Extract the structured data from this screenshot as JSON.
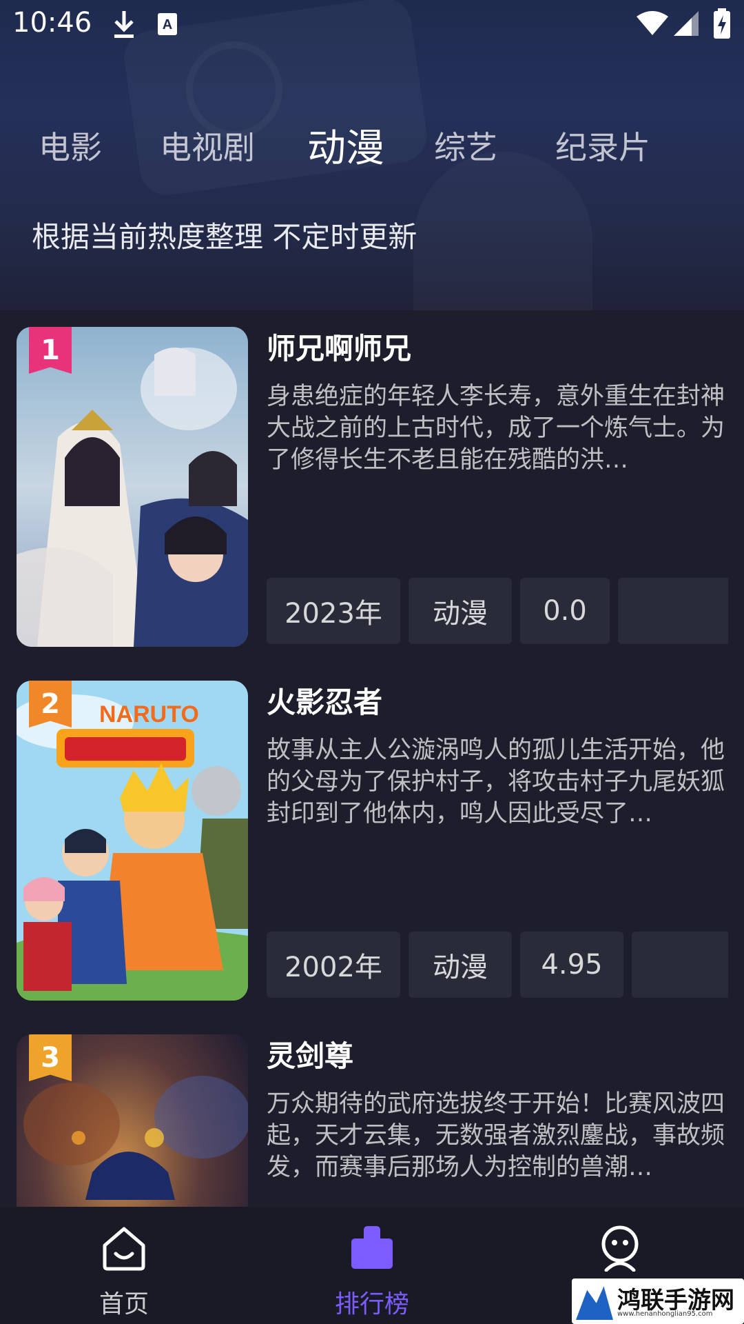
{
  "status_bar": {
    "time": "10:46",
    "icons": [
      "download-icon",
      "autofill-a-icon",
      "wifi-icon",
      "signal-icon",
      "battery-charging-icon"
    ]
  },
  "header": {
    "tabs": [
      {
        "label": "电影",
        "active": false
      },
      {
        "label": "电视剧",
        "active": false
      },
      {
        "label": "动漫",
        "active": true
      },
      {
        "label": "综艺",
        "active": false
      },
      {
        "label": "纪录片",
        "active": false
      }
    ],
    "subtitle": "根据当前热度整理 不定时更新"
  },
  "ranking": {
    "items": [
      {
        "rank": "1",
        "rank_color": "#e8337a",
        "title": "师兄啊师兄",
        "description": "身患绝症的年轻人李长寿，意外重生在封神大战之前的上古时代，成了一个炼气士。为了修得长生不老且能在残酷的洪…",
        "tags": [
          "2023年",
          "动漫",
          "0.0"
        ]
      },
      {
        "rank": "2",
        "rank_color": "#f0882a",
        "title": "火影忍者",
        "description": "故事从主人公漩涡鸣人的孤儿生活开始，他的父母为了保护村子，将攻击村子九尾妖狐封印到了他体内，鸣人因此受尽了…",
        "tags": [
          "2002年",
          "动漫",
          "4.95"
        ]
      },
      {
        "rank": "3",
        "rank_color": "#f0a32a",
        "title": "灵剑尊",
        "description": "万众期待的武府选拔终于开始！比赛风波四起，天才云集，无数强者激烈鏖战，事故频发，而赛事后那场人为控制的兽潮…",
        "tags": []
      }
    ]
  },
  "bottom_nav": {
    "items": [
      {
        "label": "首页",
        "icon": "home-icon",
        "active": false
      },
      {
        "label": "排行榜",
        "icon": "ranking-icon",
        "active": true
      },
      {
        "label": "",
        "icon": "profile-icon",
        "active": false
      }
    ],
    "accent": "#7c5cff"
  },
  "watermark": {
    "text": "鸿联手游网",
    "url": "www.henanhonglian95.com"
  }
}
